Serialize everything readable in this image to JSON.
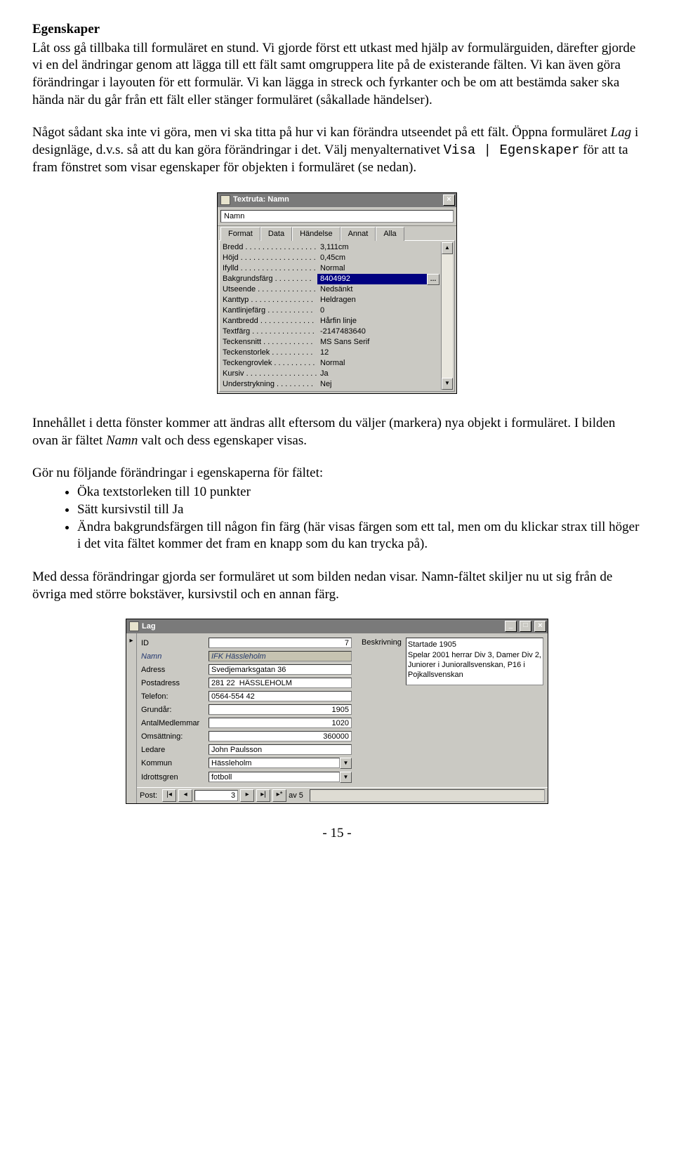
{
  "heading": "Egenskaper",
  "para1": "Låt oss gå tillbaka till formuläret en stund. Vi gjorde först ett utkast med hjälp av formulärguiden, därefter gjorde vi en del ändringar genom att lägga till ett fält samt omgruppera lite på de existerande fälten. Vi kan även göra förändringar i layouten för ett formulär. Vi kan lägga in streck och fyrkanter och be om att bestämda saker ska hända när du går från ett fält eller stänger formuläret (såkallade händelser).",
  "para2_pre": "Något sådant ska inte vi göra, men vi ska titta på hur vi kan förändra utseendet på ett fält. Öppna formuläret ",
  "para2_lag": "Lag",
  "para2_mid": " i designläge, d.v.s. så att du kan göra förändringar i det. Välj menyalternativet ",
  "para2_menu": "Visa | Egenskaper",
  "para2_post": " för att ta fram fönstret som visar egenskaper för objekten i formuläret (se nedan).",
  "propsWin": {
    "title": "Textruta: Namn",
    "nameValue": "Namn",
    "tabs": [
      "Format",
      "Data",
      "Händelse",
      "Annat",
      "Alla"
    ],
    "rows": [
      {
        "label": "Bredd . . . . . . . . . . . . . . . . .",
        "value": "3,111cm"
      },
      {
        "label": "Höjd . . . . . . . . . . . . . . . . . .",
        "value": "0,45cm"
      },
      {
        "label": "Ifylld . . . . . . . . . . . . . . . . . .",
        "value": "Normal"
      },
      {
        "label": "Bakgrundsfärg . . . . . . . . .",
        "value": "8404992",
        "selected": true
      },
      {
        "label": "Utseende . . . . . . . . . . . . . .",
        "value": "Nedsänkt"
      },
      {
        "label": "Kanttyp . . . . . . . . . . . . . . .",
        "value": "Heldragen"
      },
      {
        "label": "Kantlinjefärg . . . . . . . . . . .",
        "value": "0"
      },
      {
        "label": "Kantbredd . . . . . . . . . . . . .",
        "value": "Hårfin linje"
      },
      {
        "label": "Textfärg . . . . . . . . . . . . . . .",
        "value": "-2147483640"
      },
      {
        "label": "Teckensnitt . . . . . . . . . . . .",
        "value": "MS Sans Serif"
      },
      {
        "label": "Teckenstorlek . . . . . . . . . .",
        "value": "12"
      },
      {
        "label": "Teckengrovlek . . . . . . . . . .",
        "value": "Normal"
      },
      {
        "label": "Kursiv . . . . . . . . . . . . . . . . .",
        "value": "Ja"
      },
      {
        "label": "Understrykning . . . . . . . . .",
        "value": "Nej"
      }
    ]
  },
  "para3_pre": "Innehållet i detta fönster kommer att ändras allt eftersom du väljer (markera) nya objekt i formuläret. I bilden ovan är fältet ",
  "para3_namn": "Namn",
  "para3_post": " valt och dess egenskaper visas.",
  "para4": "Gör nu följande förändringar i egenskaperna för fältet:",
  "bullets": [
    "Öka textstorleken till 10 punkter",
    "Sätt kursivstil till Ja",
    "Ändra bakgrundsfärgen till någon fin färg (här visas färgen som ett tal, men om du klickar strax till höger i det vita fältet kommer det fram en knapp som du kan trycka på)."
  ],
  "para5": "Med dessa förändringar gjorda ser formuläret ut som bilden nedan visar. Namn-fältet skiljer nu ut sig från de övriga med större bokstäver, kursivstil och en annan färg.",
  "formWin": {
    "title": "Lag",
    "descLabel": "Beskrivning",
    "descValue": "Startade 1905\nSpelar 2001 herrar Div 3, Damer Div 2,\nJuniorer i Juniorallsvenskan, P16 i\nPojkallsvenskan",
    "fields": [
      {
        "label": "ID",
        "value": "7",
        "right": true
      },
      {
        "label": "Namn",
        "value": "IFK Hässleholm",
        "ital": true,
        "namn": true
      },
      {
        "label": "Adress",
        "value": "Svedjemarksgatan 36"
      },
      {
        "label": "Postadress",
        "value": "281 22  HÄSSLEHOLM"
      },
      {
        "label": "Telefon:",
        "value": "0564-554 42"
      },
      {
        "label": "Grundår:",
        "value": "1905",
        "right": true
      },
      {
        "label": "AntalMedlemmar",
        "value": "1020",
        "right": true
      },
      {
        "label": "Omsättning:",
        "value": "360000",
        "right": true
      },
      {
        "label": "Ledare",
        "value": "John Paulsson"
      },
      {
        "label": "Kommun",
        "value": "Hässleholm",
        "dropdown": true
      },
      {
        "label": "Idrottsgren",
        "value": "fotboll",
        "dropdown": true
      }
    ],
    "nav": {
      "label": "Post:",
      "current": "3",
      "total": "av 5"
    }
  },
  "pageNum": "- 15 -"
}
